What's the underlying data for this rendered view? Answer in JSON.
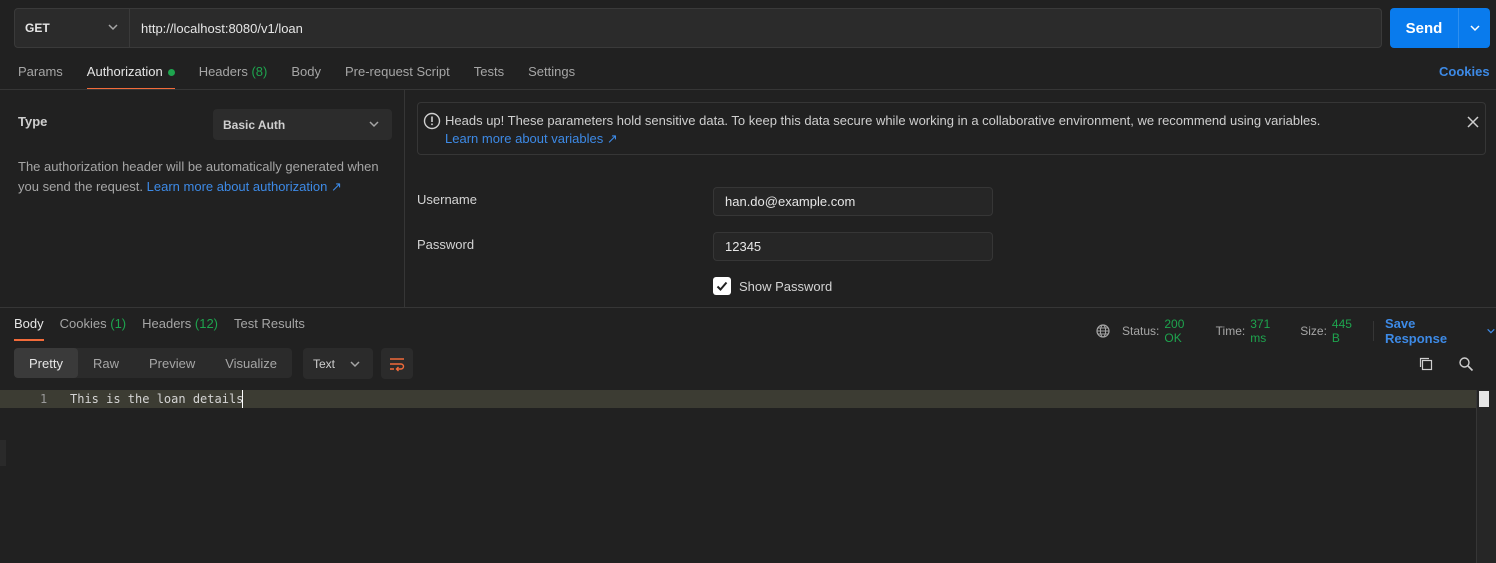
{
  "request": {
    "method": "GET",
    "url": "http://localhost:8080/v1/loan",
    "send_label": "Send"
  },
  "request_tabs": [
    {
      "label": "Params",
      "count": ""
    },
    {
      "label": "Authorization",
      "count": ""
    },
    {
      "label": "Headers",
      "count": "(8)"
    },
    {
      "label": "Body",
      "count": ""
    },
    {
      "label": "Pre-request Script",
      "count": ""
    },
    {
      "label": "Tests",
      "count": ""
    },
    {
      "label": "Settings",
      "count": ""
    }
  ],
  "cookies_link": "Cookies",
  "auth": {
    "type_label": "Type",
    "type_value": "Basic Auth",
    "description": "The authorization header will be automatically generated when you send the request.",
    "learn_more": "Learn more about authorization ↗",
    "alert_message": "Heads up! These parameters hold sensitive data. To keep this data secure while working in a collaborative environment, we recommend using variables.",
    "alert_link": "Learn more about variables ↗",
    "username_label": "Username",
    "username_value": "han.do@example.com",
    "password_label": "Password",
    "password_value": "12345",
    "show_password_label": "Show Password",
    "show_password_checked": true
  },
  "response_tabs": [
    {
      "label": "Body",
      "count": ""
    },
    {
      "label": "Cookies",
      "count": "(1)"
    },
    {
      "label": "Headers",
      "count": "(12)"
    },
    {
      "label": "Test Results",
      "count": ""
    }
  ],
  "response_stats": {
    "status_label": "Status:",
    "status_value": "200 OK",
    "time_label": "Time:",
    "time_value": "371 ms",
    "size_label": "Size:",
    "size_value": "445 B",
    "save_response": "Save Response"
  },
  "format_buttons": [
    "Pretty",
    "Raw",
    "Preview",
    "Visualize"
  ],
  "format_type": "Text",
  "code": {
    "line_number": "1",
    "content": "This is the loan details"
  },
  "colors": {
    "accent": "#f26b3a",
    "primary": "#097bed",
    "success": "#1ea44e",
    "link": "#3d8ae6"
  }
}
